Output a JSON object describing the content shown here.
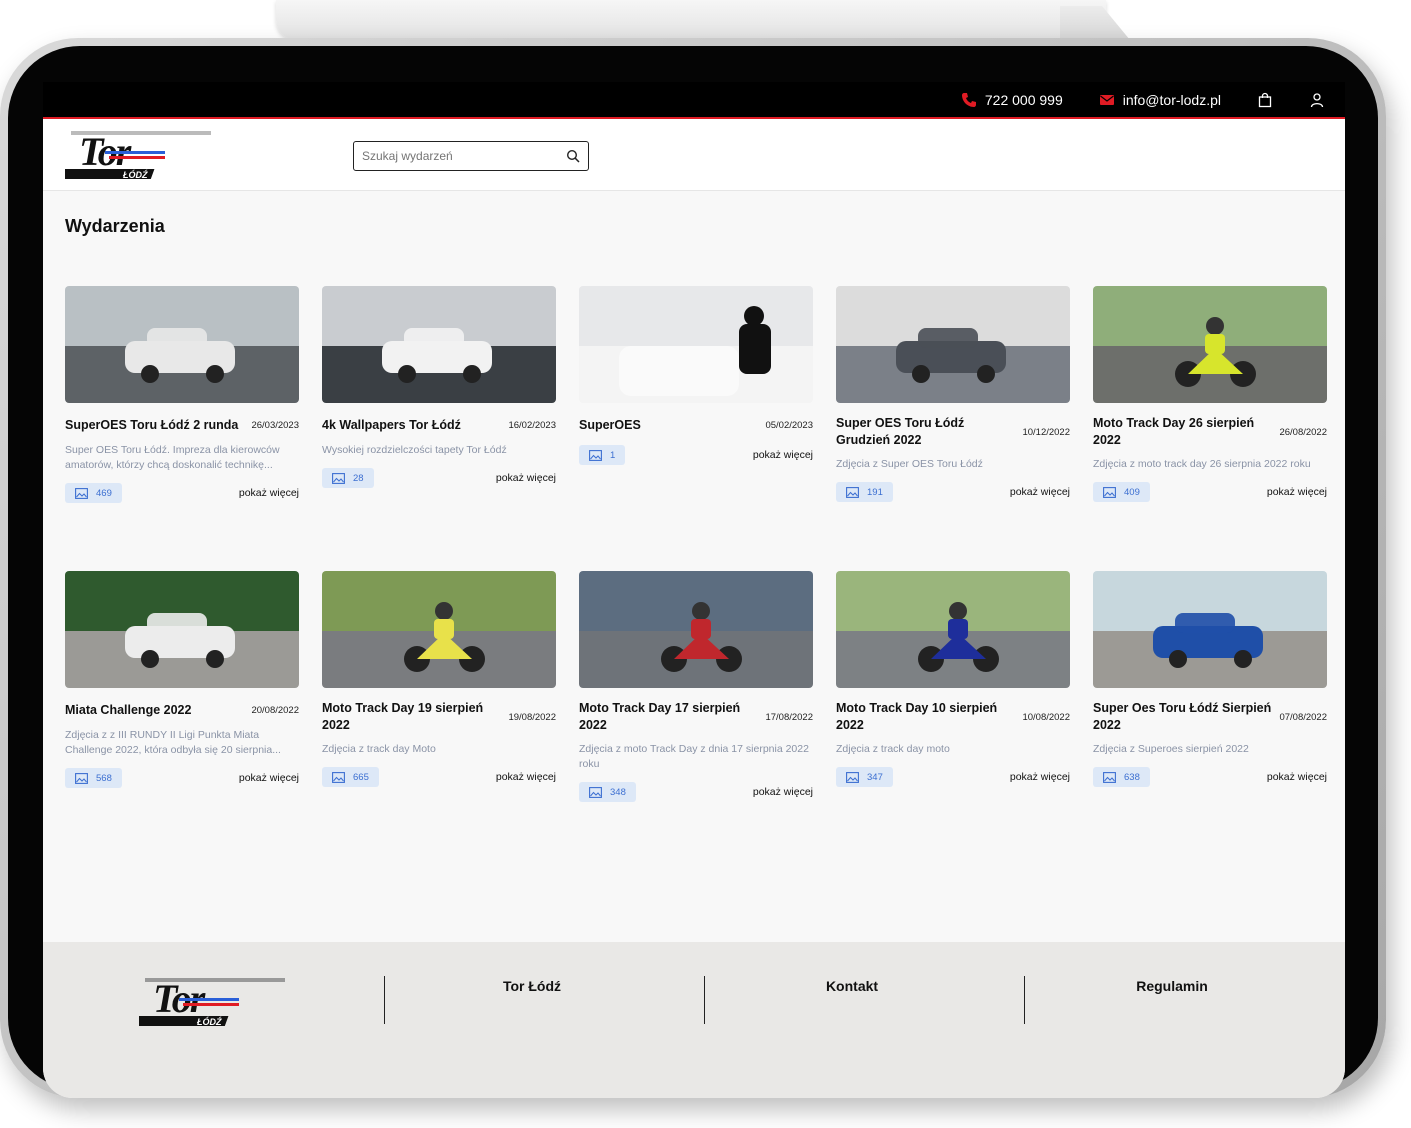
{
  "topbar": {
    "phone": "722 000 999",
    "email": "info@tor-lodz.pl",
    "icons": [
      "phone-icon",
      "mail-icon",
      "bag-icon",
      "user-icon"
    ]
  },
  "brand": {
    "logo_text": "Tor",
    "logo_sub": "ŁÓDŹ"
  },
  "search": {
    "placeholder": "Szukaj wydarzeń"
  },
  "page": {
    "title": "Wydarzenia"
  },
  "more_label": "pokaż więcej",
  "events": [
    {
      "title": "SuperOES Toru Łódź 2 runda",
      "date": "26/03/2023",
      "desc": "Super OES Toru Łódź. Impreza dla kierowców amatorów, którzy chcą doskonalić technikę...",
      "count": "469"
    },
    {
      "title": "4k Wallpapers Tor Łódź",
      "date": "16/02/2023",
      "desc": "Wysokiej rozdzielczości tapety Tor Łódź",
      "count": "28"
    },
    {
      "title": "SuperOES",
      "date": "05/02/2023",
      "desc": "",
      "count": "1"
    },
    {
      "title": "Super OES Toru Łódź Grudzień 2022",
      "date": "10/12/2022",
      "desc": "Zdjęcia z Super OES Toru Łódź",
      "count": "191"
    },
    {
      "title": "Moto Track Day 26 sierpień 2022",
      "date": "26/08/2022",
      "desc": "Zdjęcia z moto track day 26 sierpnia 2022 roku",
      "count": "409"
    },
    {
      "title": "Miata Challenge 2022",
      "date": "20/08/2022",
      "desc": "Zdjęcia z z III RUNDY II Ligi Punkta Miata Challenge 2022, która odbyła się 20 sierpnia...",
      "count": "568"
    },
    {
      "title": "Moto Track Day 19 sierpień 2022",
      "date": "19/08/2022",
      "desc": "Zdjęcia z track day Moto",
      "count": "665"
    },
    {
      "title": "Moto Track Day 17 sierpień 2022",
      "date": "17/08/2022",
      "desc": "Zdjęcia z moto Track Day z dnia 17 sierpnia 2022 roku",
      "count": "348"
    },
    {
      "title": "Moto Track Day 10 sierpień 2022",
      "date": "10/08/2022",
      "desc": "Zdjęcia z track day moto",
      "count": "347"
    },
    {
      "title": "Super Oes Toru Łódź Sierpień 2022",
      "date": "07/08/2022",
      "desc": "Zdjęcia z Superoes sierpień 2022",
      "count": "638"
    }
  ],
  "footer": {
    "links": [
      "Tor Łódź",
      "Kontakt",
      "Regulamin"
    ]
  },
  "colors": {
    "accent": "#e01b24",
    "badge_bg": "#dde8f7",
    "badge_text": "#3c6fd1"
  }
}
